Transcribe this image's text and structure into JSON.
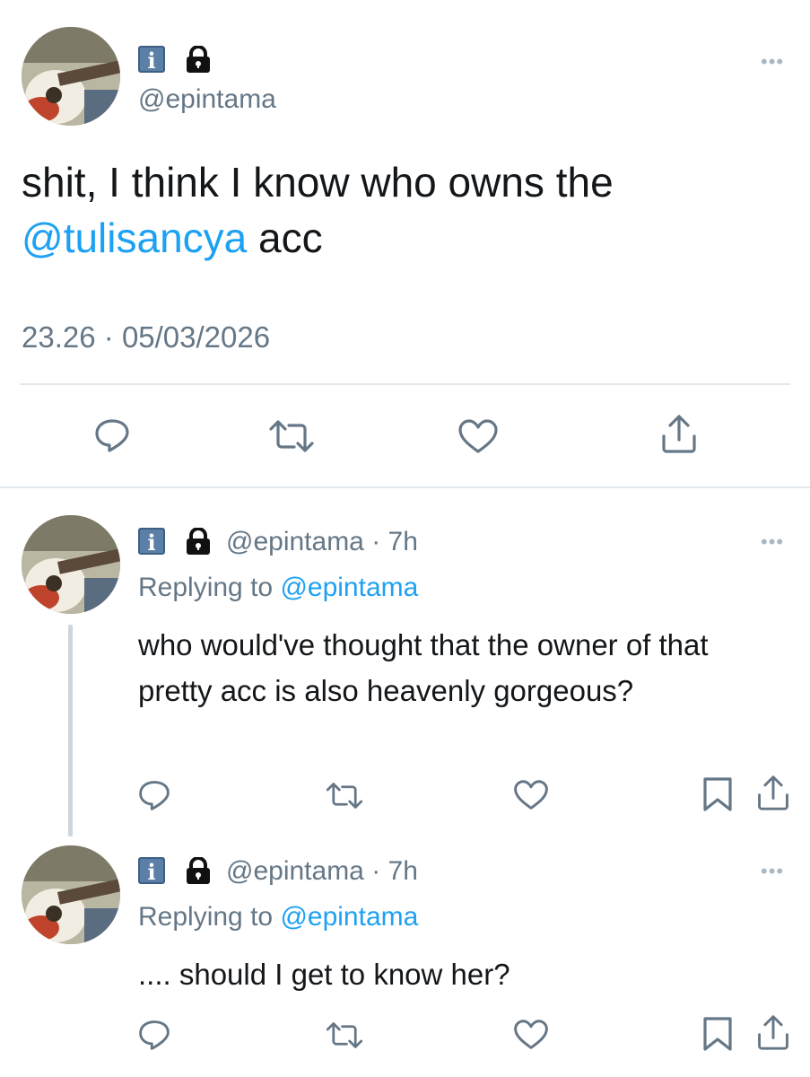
{
  "colors": {
    "accent": "#1da1f2",
    "secondary_text": "#657786",
    "icon_gray": "#657786",
    "divider": "#e1e8ed"
  },
  "main_tweet": {
    "handle": "@epintama",
    "text_plain_1": "shit, I think I know who owns the",
    "mention": "@tulisancya",
    "text_plain_2": " acc",
    "time": "23.26",
    "separator": "·",
    "date": "05/03/2026",
    "actions": [
      "reply-icon",
      "retweet-icon",
      "like-icon",
      "share-icon"
    ]
  },
  "replies": [
    {
      "handle": "@epintama",
      "time_ago": "· 7h",
      "replying_prefix": "Replying to ",
      "replying_to": "@epintama",
      "text": "who would've thought that the owner of that pretty acc is also heavenly gorgeous?",
      "actions": [
        "reply-icon",
        "retweet-icon",
        "like-icon",
        "bookmark-icon",
        "share-icon"
      ]
    },
    {
      "handle": "@epintama",
      "time_ago": "· 7h",
      "replying_prefix": "Replying to ",
      "replying_to": "@epintama",
      "text": ".... should I get to know her?",
      "actions": [
        "reply-icon",
        "retweet-icon",
        "like-icon",
        "bookmark-icon",
        "share-icon"
      ]
    }
  ],
  "name_badge": "i",
  "more_label": "•••"
}
